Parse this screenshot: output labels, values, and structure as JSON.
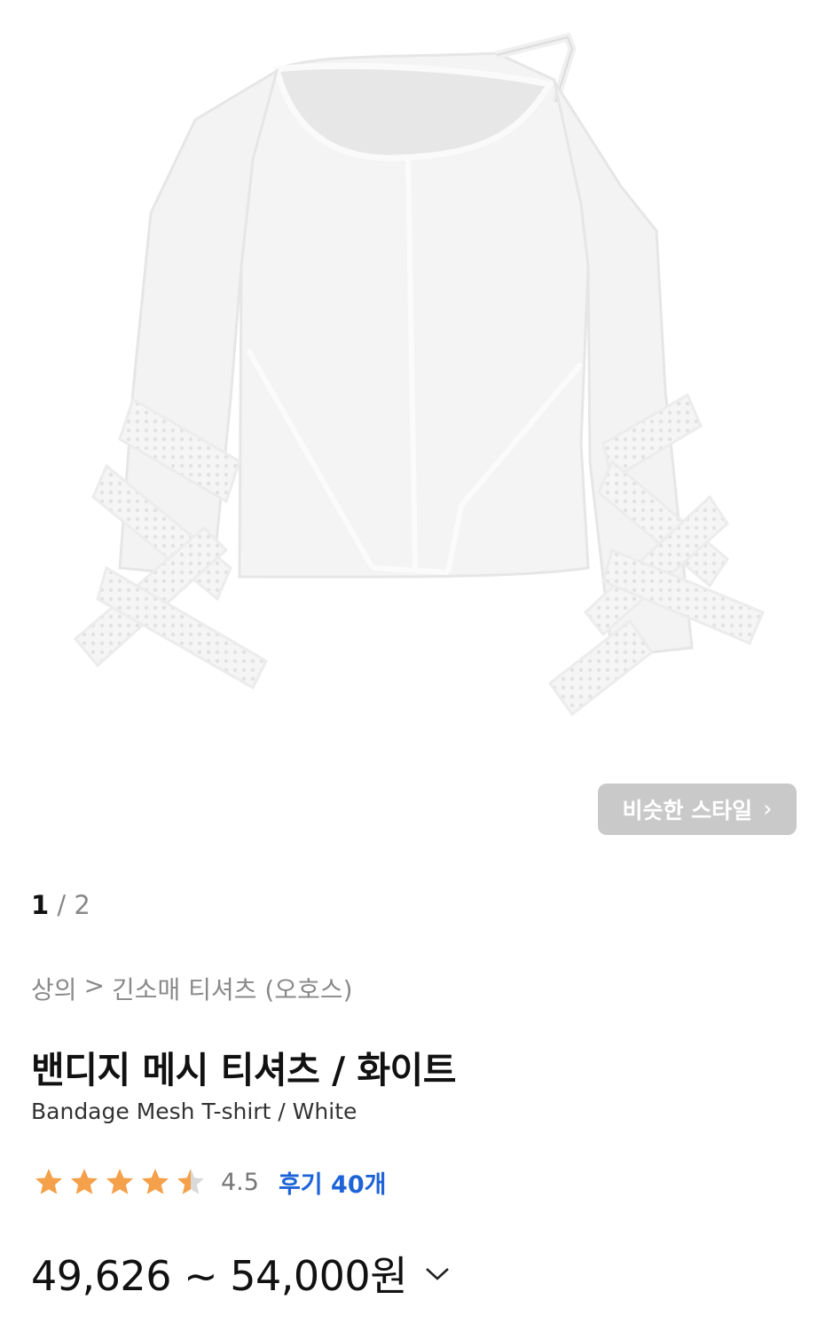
{
  "gallery": {
    "similar_style_label": "비슷한 스타일",
    "page_current": "1",
    "page_separator": "/",
    "page_total": "2"
  },
  "breadcrumb": {
    "category": "상의",
    "separator": ">",
    "subcategory": "긴소매 티셔츠 (오호스)"
  },
  "product": {
    "title_ko": "밴디지 메시 티셔츠 / 화이트",
    "title_en": "Bandage Mesh T-shirt / White",
    "rating_value": "4.5",
    "rating_stars": 4.5,
    "rating_max": 5,
    "reviews_label": "후기 40개",
    "price_range": "49,626 ~ 54,000원"
  },
  "colors": {
    "star": "#f5a04a",
    "star_empty": "#d9d9d9",
    "link": "#1e63d8",
    "button_bg": "#c9c9c9"
  }
}
